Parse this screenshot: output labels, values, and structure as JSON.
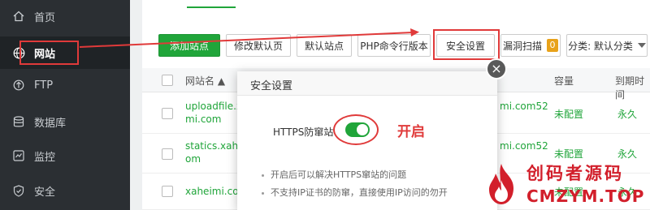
{
  "sidebar": {
    "items": [
      {
        "label": "首页",
        "icon": "home-icon"
      },
      {
        "label": "网站",
        "icon": "globe-icon"
      },
      {
        "label": "FTP",
        "icon": "ftp-icon"
      },
      {
        "label": "数据库",
        "icon": "database-icon"
      },
      {
        "label": "监控",
        "icon": "monitor-icon"
      },
      {
        "label": "安全",
        "icon": "shield-icon"
      }
    ],
    "active_index": 1
  },
  "toolbar": {
    "add_site": "添加站点",
    "edit_default_page": "修改默认页",
    "default_site": "默认站点",
    "php_cli": "PHP命令行版本",
    "security_settings": "安全设置",
    "vuln_scan": "漏洞扫描",
    "vuln_count": "0",
    "category": "分类: 默认分类"
  },
  "table": {
    "headers": {
      "site_name": "网站名 ▲",
      "capacity": "容量",
      "expire": "到期时间"
    },
    "rows": [
      {
        "name_line1": "uploadfile.x",
        "name_line2": "mi.com",
        "domain": "mi.com52",
        "capacity": "未配置",
        "expire": "永久"
      },
      {
        "name_line1": "statics.xahe",
        "name_line2": "om",
        "domain": "mi.com52",
        "capacity": "未配置",
        "expire": "永久"
      },
      {
        "name_line1": "xaheimi.com",
        "name_line2": "",
        "domain": "",
        "capacity": "未配置",
        "expire": "永久"
      }
    ]
  },
  "modal": {
    "title": "安全设置",
    "option_label": "HTTPS防窜站",
    "toggle_on": true,
    "annotation": "开启",
    "tips": [
      "开启后可以解决HTTPS窜站的问题",
      "不支持IP证书的防窜，直接使用IP访问的勿开"
    ],
    "close_symbol": "×"
  },
  "watermark": {
    "cn": "创码者源码",
    "en": "CMZYM.TOP"
  },
  "colors": {
    "accent_green": "#20a53a",
    "annotation_red": "#e03a3a",
    "sidebar_bg": "#2b2f33",
    "watermark_red": "#d21f2b"
  }
}
